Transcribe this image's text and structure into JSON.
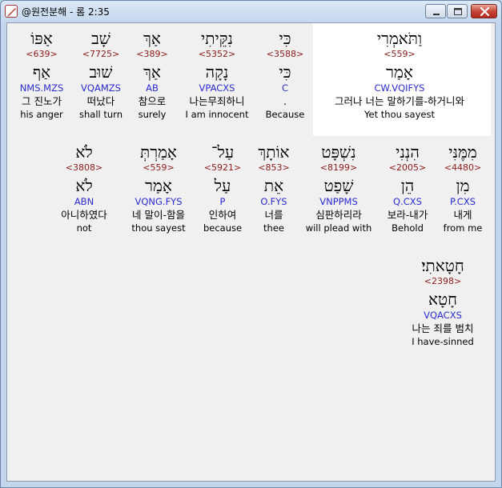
{
  "window": {
    "title": "@원전분해 - 롬 2:35",
    "app_icon": "bible-app-icon",
    "controls": {
      "minimize": "minimize-icon",
      "maximize": "maximize-icon",
      "close": "close-icon"
    }
  },
  "rows": [
    {
      "words": [
        {
          "hebrew": "אַפּוֹ",
          "strong": "<639>",
          "lemma": "אַף",
          "morph": "NMS.MZS",
          "korean": "그 진노가",
          "english": "his anger"
        },
        {
          "hebrew": "שָׁב",
          "strong": "<7725>",
          "lemma": "שׁוּב",
          "morph": "VQAMZS",
          "korean": "떠났다",
          "english": "shall turn"
        },
        {
          "hebrew": "אַךְ",
          "strong": "<389>",
          "lemma": "אַךְ",
          "morph": "AB",
          "korean": "참으로",
          "english": "surely"
        },
        {
          "hebrew": "נִקֵּיתִי",
          "strong": "<5352>",
          "lemma": "נָקָה",
          "morph": "VPACXS",
          "korean": "나는무죄하니",
          "english": "I am innocent"
        },
        {
          "hebrew": "כִּי",
          "strong": "<3588>",
          "lemma": "כִּי",
          "morph": "C",
          "korean": ".",
          "english": "Because"
        },
        {
          "hebrew": "וַתֹּאמְרִי",
          "strong": "<559>",
          "lemma": "אָמַר",
          "morph": "CW.VQIFYS",
          "korean": "그러나 너는 말하기를-하거니와",
          "english": "Yet thou sayest",
          "selected": true
        }
      ]
    },
    {
      "words": [
        {
          "hebrew": "לֹא",
          "strong": "<3808>",
          "lemma": "לֹא",
          "morph": "ABN",
          "korean": "아니하였다",
          "english": "not"
        },
        {
          "hebrew": "אָמַרְתְּ",
          "strong": "<559>",
          "lemma": "אָמַר",
          "morph": "VQNG.FYS",
          "korean": "네 말이-함을",
          "english": "thou sayest"
        },
        {
          "hebrew": "עַל־",
          "strong": "<5921>",
          "lemma": "עַל",
          "morph": "P",
          "korean": "인하여",
          "english": "because"
        },
        {
          "hebrew": "אוֹתָךְ",
          "strong": "<853>",
          "lemma": "אֵת",
          "morph": "O.FYS",
          "korean": "너를",
          "english": "thee"
        },
        {
          "hebrew": "נִשְׁפָּט",
          "strong": "<8199>",
          "lemma": "שָׁפַט",
          "morph": "VNPPMS",
          "korean": "심판하리라",
          "english": "will plead with"
        },
        {
          "hebrew": "הִנְנִי",
          "strong": "<2005>",
          "lemma": "הֵן",
          "morph": "Q.CXS",
          "korean": "보라-내가",
          "english": "Behold"
        },
        {
          "hebrew": "מִמֶּנִּי",
          "strong": "<4480>",
          "lemma": "מִן",
          "morph": "P.CXS",
          "korean": "내게",
          "english": "from me"
        }
      ]
    },
    {
      "words": [
        {
          "hebrew": "חָטָאתִי׃",
          "strong": "<2398>",
          "lemma": "חָטָא",
          "morph": "VQACXS",
          "korean": "나는 죄를 범치",
          "english": "I have-sinned"
        }
      ]
    }
  ]
}
